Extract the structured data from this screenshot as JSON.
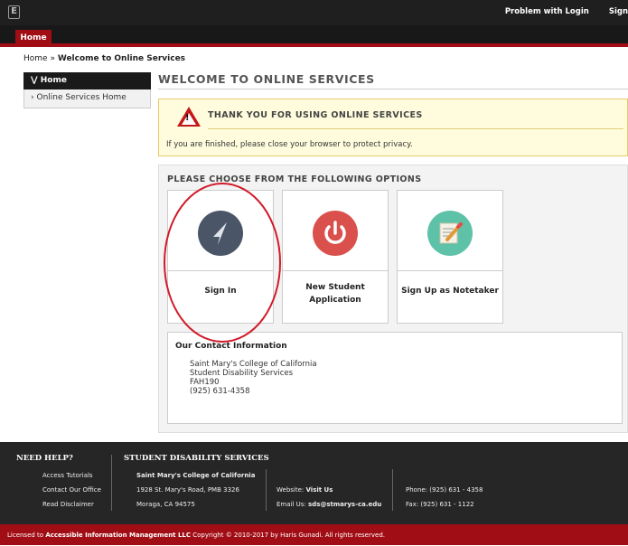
{
  "top": {
    "logo": "E",
    "links": [
      "Problem with Login",
      "Sign"
    ]
  },
  "nav": {
    "home_tab": "Home"
  },
  "breadcrumb": {
    "home": "Home",
    "separator": "»",
    "current": "Welcome to Online Services"
  },
  "sidebar": {
    "head": "Home",
    "items": [
      {
        "label": "Online Services Home"
      }
    ]
  },
  "page": {
    "title": "WELCOME TO ONLINE SERVICES"
  },
  "notice": {
    "title": "THANK YOU FOR USING ONLINE SERVICES",
    "text": "If you are finished, please close your browser to protect privacy."
  },
  "options": {
    "title": "PLEASE CHOOSE FROM THE FOLLOWING OPTIONS",
    "items": [
      {
        "label": "Sign In",
        "icon": "cursor-icon",
        "color": "#4a5668"
      },
      {
        "label": "New Student Application",
        "icon": "power-icon",
        "color": "#d9504c"
      },
      {
        "label": "Sign Up as Notetaker",
        "icon": "notepad-pencil-icon",
        "color": "#5ec2a8"
      }
    ]
  },
  "contact": {
    "title": "Our Contact Information",
    "lines": [
      "Saint Mary's College of California",
      "Student Disability Services",
      "FAH190",
      "(925) 631-4358"
    ]
  },
  "footer": {
    "help_title": "NEED HELP?",
    "help_links": [
      "Access Tutorials",
      "Contact Our Office",
      "Read Disclaimer"
    ],
    "sds_title": "STUDENT DISABILITY SERVICES",
    "college": "Saint Mary's College of California",
    "address1": "1928 St. Mary's Road, PMB 3326",
    "address2": "Moraga, CA 94575",
    "website_label": "Website:",
    "website_link": "Visit Us",
    "email_label": "Email Us:",
    "email": "sds@stmarys-ca.edu",
    "phone": "Phone: (925) 631 - 4358",
    "fax": "Fax: (925) 631 - 1122"
  },
  "license": {
    "prefix": "Licensed to",
    "company": "Accessible Information Management LLC",
    "suffix": "Copyright © 2010-2017 by Haris Gunadi. All rights reserved."
  },
  "colors": {
    "brand_red": "#a10d14",
    "annotation_red": "#d21a2a"
  }
}
